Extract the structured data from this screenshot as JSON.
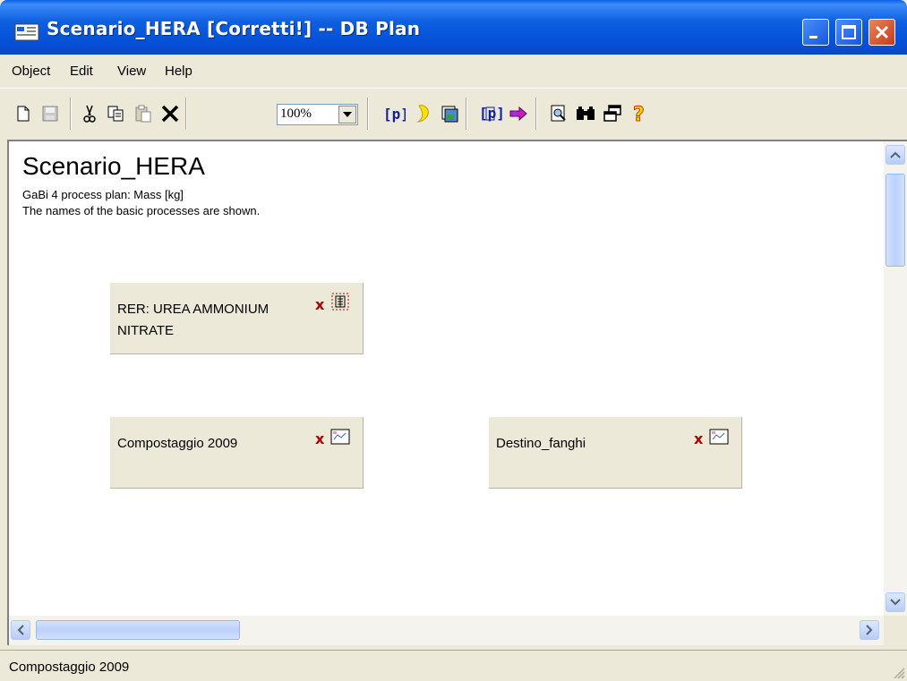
{
  "window": {
    "title": "Scenario_HERA [Corretti!] -- DB Plan",
    "controls": {
      "minimize": "minimize-icon",
      "maximize": "maximize-icon",
      "close": "close-icon"
    }
  },
  "menu": [
    {
      "label": "Object"
    },
    {
      "label": "Edit"
    },
    {
      "label": "View"
    },
    {
      "label": "Help"
    }
  ],
  "toolbar": {
    "zoom": {
      "value": "100%"
    },
    "icons": [
      "new-document-icon",
      "save-icon",
      "cut-icon",
      "copy-icon",
      "paste-icon",
      "delete-icon",
      "zoom-select",
      "process-icon",
      "light-bulb-icon",
      "image-icon",
      "process-parameters-icon",
      "arrows-icon",
      "preview-icon",
      "find-binoculars-icon",
      "windows-icon",
      "help-icon"
    ]
  },
  "plan": {
    "title": "Scenario_HERA",
    "subtitle": "GaBi 4 process plan: Mass [kg]",
    "note": "The names of the basic processes are shown."
  },
  "processes": [
    {
      "label_line1": "RER: UREA AMMONIUM",
      "label_line2": "NITRATE",
      "marker": "x",
      "icon": "aggregated-process-icon"
    },
    {
      "label_line1": "Compostaggio 2009",
      "label_line2": "",
      "marker": "x",
      "icon": "plan-icon"
    },
    {
      "label_line1": "Destino_fanghi",
      "label_line2": "",
      "marker": "x",
      "icon": "plan-icon"
    }
  ],
  "status": {
    "text": "Compostaggio 2009"
  },
  "colors": {
    "titlebar": "#0550d6",
    "process_box": "#ece9d8",
    "marker": "#b00000",
    "canvas": "#ffffff"
  }
}
